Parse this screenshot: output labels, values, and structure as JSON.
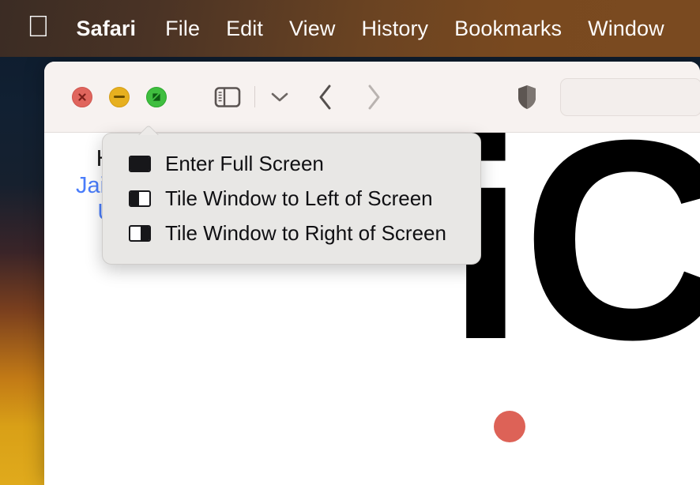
{
  "menubar": {
    "apple_logo": "",
    "items": [
      {
        "label": "Safari",
        "bold": true
      },
      {
        "label": "File",
        "bold": false
      },
      {
        "label": "Edit",
        "bold": false
      },
      {
        "label": "View",
        "bold": false
      },
      {
        "label": "History",
        "bold": false
      },
      {
        "label": "Bookmarks",
        "bold": false
      },
      {
        "label": "Window",
        "bold": false
      }
    ]
  },
  "window": {
    "traffic_lights": [
      {
        "name": "close",
        "color": "#e0655d",
        "glyph": "x"
      },
      {
        "name": "minimize",
        "color": "#e7b01f",
        "glyph": "minus"
      },
      {
        "name": "maximize",
        "color": "#3fbe3f",
        "glyph": "fullscreen-diagonal"
      }
    ],
    "toolbar": {
      "sidebar_icon": "sidebar-toggle-icon",
      "dropdown_icon": "chevron-down-icon",
      "back_icon": "chevron-left-icon",
      "forward_icon": "chevron-right-icon",
      "shield_icon": "privacy-shield-icon",
      "address_value": "",
      "address_placeholder": ""
    }
  },
  "popup_menu": {
    "items": [
      {
        "label": "Enter Full Screen",
        "icon": "full-screen-icon"
      },
      {
        "label": "Tile Window to Left of Screen",
        "icon": "tile-left-icon"
      },
      {
        "label": "Tile Window to Right of Screen",
        "icon": "tile-right-icon"
      }
    ]
  },
  "page": {
    "howto": {
      "line1": "How to",
      "line2": "Jailbreak",
      "line3": "Unlock",
      "line1_color": "#141414",
      "link_color": "#4a7dfb"
    },
    "logo": {
      "text": "iCl",
      "dot_color": "#dd6257",
      "text_color": "#000000"
    },
    "devices_alt": "ipad-iphone-devices-image"
  },
  "colors": {
    "menubar_start": "#3b2c24",
    "menubar_end": "#7a4a20",
    "toolbar_bg": "#f7f2f0",
    "popup_bg": "#e8e7e5",
    "wallpaper_top": "#0d1b2c",
    "wallpaper_bottom": "#e0aa1c"
  }
}
